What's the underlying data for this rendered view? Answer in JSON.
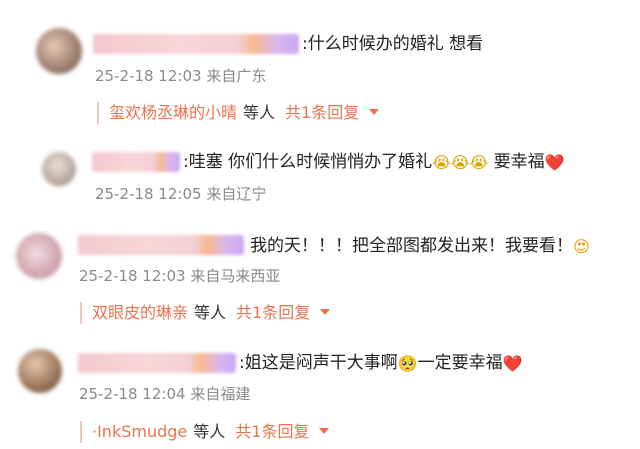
{
  "comments": [
    {
      "text": ":什么时候办的婚礼 想看",
      "time": "25-2-18 12:03",
      "location": "来自广东",
      "reply": {
        "user": "玺欢杨丞琳的小晴",
        "etc": "等人",
        "count": "共1条回复"
      }
    },
    {
      "text": ":哇塞 你们什么时候悄悄办了婚礼",
      "emoji": [
        "😭",
        "😭",
        "😭"
      ],
      "text2": " 要幸福",
      "emoji2": "❤️",
      "time": "25-2-18 12:05",
      "location": "来自辽宁"
    },
    {
      "text": "我的天！！！把全部图都发出来！我要看！",
      "emoji": "😍",
      "time": "25-2-18 12:03",
      "location": "来自马来西亚",
      "reply": {
        "user": "双眼皮的琳亲",
        "etc": "等人",
        "count": "共1条回复"
      }
    },
    {
      "text": ":姐这是闷声干大事啊",
      "emoji": "🥺",
      "text2": "一定要幸福",
      "emoji2": "❤️",
      "time": "25-2-18 12:04",
      "location": "来自福建",
      "reply": {
        "user": "·InkSmudge",
        "etc": "等人",
        "count": "共1条回复"
      }
    }
  ],
  "colors": {
    "accent": "#eb7350",
    "meta": "#8a8a8a",
    "text": "#222222"
  },
  "icons": {
    "reply_expand": "caret-down-icon"
  }
}
